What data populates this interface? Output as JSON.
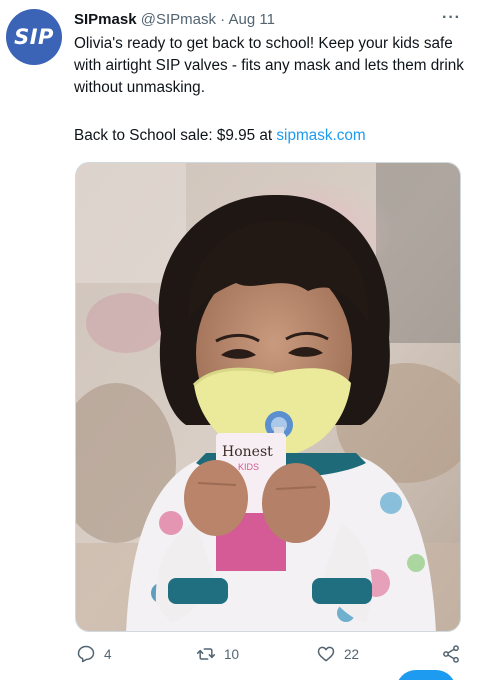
{
  "tweet": {
    "avatar_text": "SIP",
    "author_name": "SIPmask",
    "handle": "@SIPmask",
    "separator": "·",
    "date": "Aug 11",
    "more_label": "···",
    "text": "Olivia's ready to get back to school!  Keep your kids safe with airtight SIP valves - fits any mask and lets them drink without unmasking.",
    "sale_prefix": "Back to School sale:  $9.95 at ",
    "sale_link": "sipmask.com",
    "media": {
      "box_brand": "Honest",
      "box_sub": "KIDS"
    }
  },
  "actions": {
    "reply_count": "4",
    "retweet_count": "10",
    "like_count": "22"
  },
  "icons": {
    "reply": "reply-icon",
    "retweet": "retweet-icon",
    "like": "heart-icon",
    "share": "share-icon"
  },
  "colors": {
    "brand": "#3b63b6",
    "link": "#1d9bf0",
    "muted": "#536471"
  }
}
